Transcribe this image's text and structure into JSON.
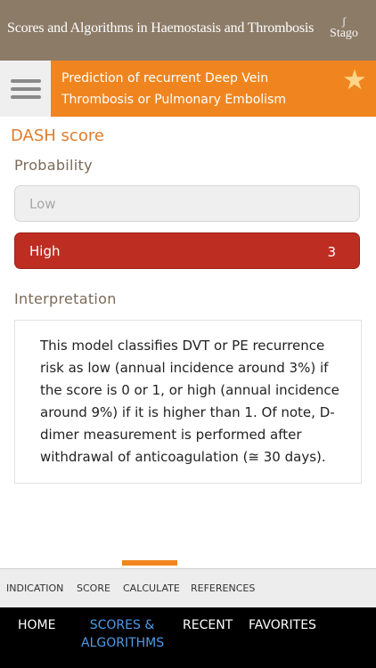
{
  "header": {
    "title": "Scores and Algorithms in Haemostasis and Thrombosis",
    "logo_text": "Stago"
  },
  "topbar": {
    "title": "Prediction of recurrent Deep Vein Thrombosis or Pulmonary Embolism"
  },
  "score": {
    "title": "DASH score",
    "probability_label": "Probability",
    "options": [
      {
        "label": "Low",
        "value": "",
        "selected": false
      },
      {
        "label": "High",
        "value": "3",
        "selected": true
      }
    ],
    "interpretation_label": "Interpretation",
    "interpretation_text": "This model classifies DVT or PE recurrence risk as low (annual incidence around 3%) if the score is 0 or 1, or high (annual incidence around 9%) if it is higher than 1. Of note, D-dimer measurement is performed after withdrawal of anticoagulation (≅ 30 days)."
  },
  "subtabs": [
    "INDICATION",
    "SCORE",
    "CALCULATE",
    "REFERENCES"
  ],
  "nav": {
    "home": "HOME",
    "scores_line1": "SCORES &",
    "scores_line2": "ALGORITHMS",
    "recent": "RECENT",
    "favorites": "FAVORITES"
  },
  "colors": {
    "header": "#8c7b67",
    "accent": "#f0851f",
    "high_selected": "#be2d22",
    "nav_active": "#4d9be8"
  }
}
